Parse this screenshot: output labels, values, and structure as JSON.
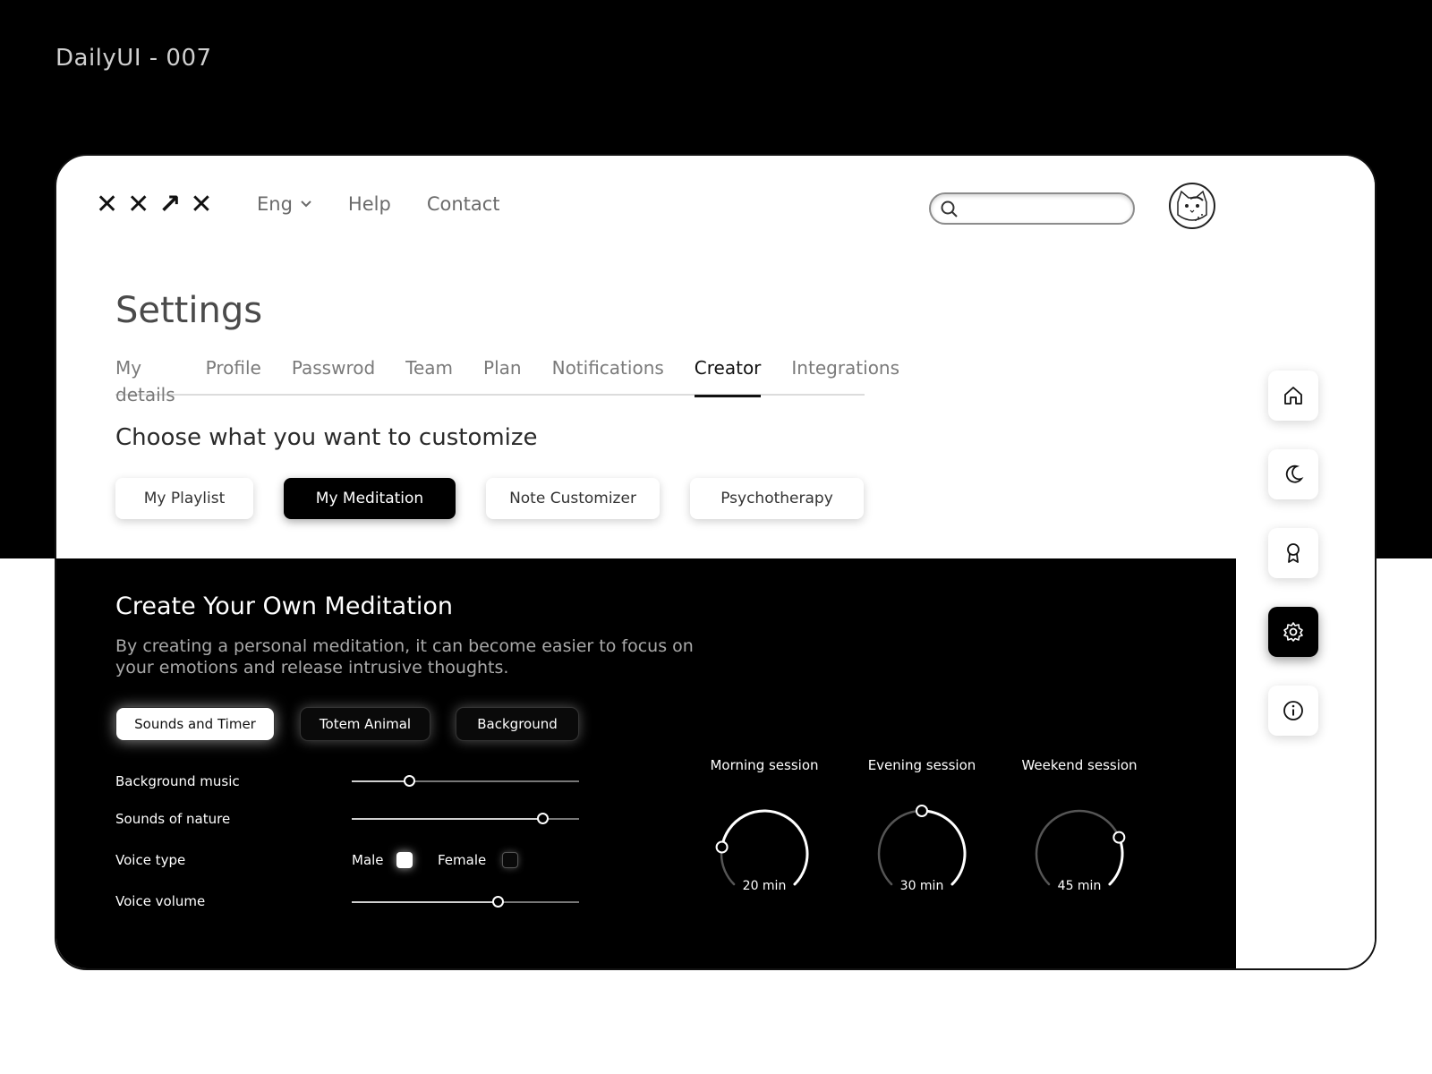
{
  "shot_title": "DailyUI - 007",
  "logo": [
    "✕",
    "✕",
    "↗",
    "✕"
  ],
  "topnav": {
    "language": "Eng",
    "help": "Help",
    "contact": "Contact"
  },
  "search": {
    "placeholder": ""
  },
  "page_title": "Settings",
  "tabs": [
    {
      "label": "My details",
      "active": false
    },
    {
      "label": "Profile",
      "active": false
    },
    {
      "label": "Passwrod",
      "active": false
    },
    {
      "label": "Team",
      "active": false
    },
    {
      "label": "Plan",
      "active": false
    },
    {
      "label": "Notifications",
      "active": false
    },
    {
      "label": "Creator",
      "active": true
    },
    {
      "label": "Integrations",
      "active": false
    }
  ],
  "choose_heading": "Choose what you want to customize",
  "categories": [
    {
      "label": "My Playlist",
      "active": false
    },
    {
      "label": "My Meditation",
      "active": true
    },
    {
      "label": "Note Customizer",
      "active": false
    },
    {
      "label": "Psychotherapy",
      "active": false
    }
  ],
  "creator": {
    "title": "Create Your Own Meditation",
    "description": "By creating a personal meditation, it can become easier to focus on your emotions and release intrusive thoughts.",
    "subtabs": [
      {
        "label": "Sounds and Timer",
        "active": true
      },
      {
        "label": "Totem Animal",
        "active": false
      },
      {
        "label": "Background",
        "active": false
      }
    ],
    "controls": {
      "background_music": {
        "label": "Background music",
        "level": 0.25
      },
      "sounds_of_nature": {
        "label": "Sounds of nature",
        "level": 0.84
      },
      "voice_type": {
        "label": "Voice type",
        "male": "Male",
        "female": "Female",
        "male_checked": true,
        "female_checked": false
      },
      "voice_volume": {
        "label": "Voice volume",
        "level": 0.64
      }
    },
    "sessions": [
      {
        "title": "Morning session",
        "time": "20 min",
        "level": 0.2
      },
      {
        "title": "Evening session",
        "time": "30 min",
        "level": 0.5
      },
      {
        "title": "Weekend session",
        "time": "45 min",
        "level": 0.75
      }
    ]
  },
  "rail": [
    {
      "icon": "home-icon",
      "active": false
    },
    {
      "icon": "moon-icon",
      "active": false
    },
    {
      "icon": "award-icon",
      "active": false
    },
    {
      "icon": "gear-icon",
      "active": true
    },
    {
      "icon": "info-icon",
      "active": false
    }
  ],
  "colors": {
    "background_top": "#000000",
    "card": "#ffffff",
    "accent": "#000000",
    "muted_text": "#7a7a7a"
  }
}
